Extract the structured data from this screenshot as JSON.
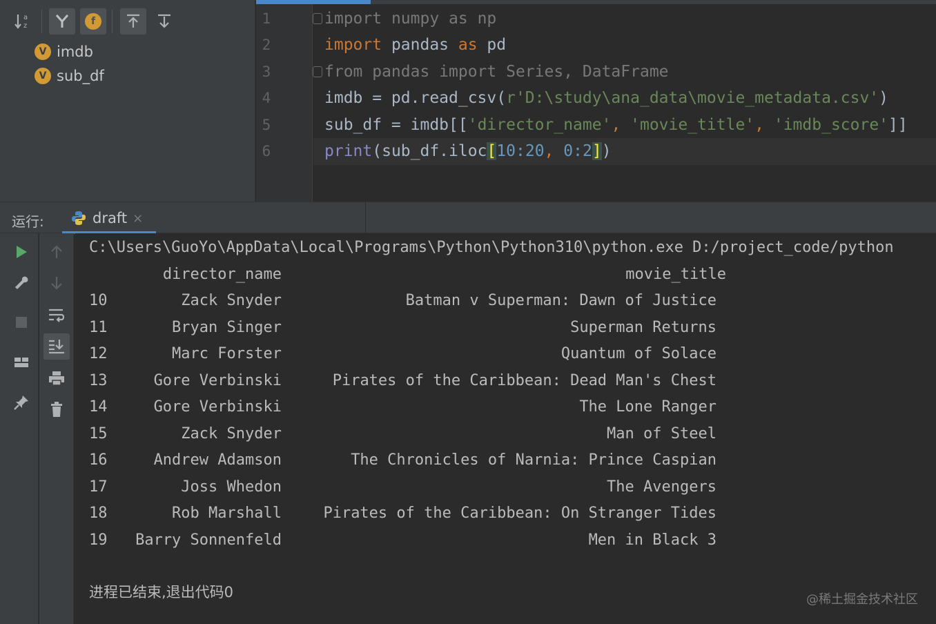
{
  "structure": {
    "items": [
      {
        "badge": "V",
        "label": "imdb"
      },
      {
        "badge": "V",
        "label": "sub_df"
      }
    ],
    "toolbar_icons": [
      "sort-alpha-icon",
      "filter-icon",
      "show-fields-icon",
      "expand-icon",
      "collapse-icon"
    ],
    "field_badge": "f"
  },
  "editor": {
    "lines": [
      {
        "no": "1"
      },
      {
        "no": "2"
      },
      {
        "no": "3"
      },
      {
        "no": "4"
      },
      {
        "no": "5"
      },
      {
        "no": "6"
      }
    ],
    "code": {
      "l1_import": "import",
      "l1_rest": " numpy ",
      "l1_as": "as",
      "l1_np": " np",
      "l2_import": "import",
      "l2_mod": " pandas ",
      "l2_as": "as",
      "l2_alias": " pd",
      "l3_from": "from",
      "l3_mod": " pandas ",
      "l3_import": "import",
      "l3_names": " Series, DataFrame",
      "l4_pre": "imdb = pd.read_csv(",
      "l4_str": "r'D:\\study\\ana_data\\movie_metadata.csv'",
      "l4_post": ")",
      "l5_pre": "sub_df = imdb[[",
      "l5_s1": "'director_name'",
      "l5_c1": ", ",
      "l5_s2": "'movie_title'",
      "l5_c2": ", ",
      "l5_s3": "'imdb_score'",
      "l5_post": "]]",
      "l6_print": "print",
      "l6_mid": "(sub_df.iloc",
      "l6_lb": "[",
      "l6_n1": "10",
      "l6_c1": ":",
      "l6_n2": "20",
      "l6_c2": ", ",
      "l6_n3": "0",
      "l6_c3": ":",
      "l6_n4": "2",
      "l6_rb": "]",
      "l6_post": ")"
    }
  },
  "run": {
    "label": "运行:",
    "tab_name": "draft",
    "tab_close": "×"
  },
  "console": {
    "command": "C:\\Users\\GuoYo\\AppData\\Local\\Programs\\Python\\Python310\\python.exe D:/project_code/python",
    "header_director": "director_name",
    "header_title": "movie_title",
    "rows": [
      {
        "idx": "10",
        "director": "Zack Snyder",
        "title": "Batman v Superman: Dawn of Justice"
      },
      {
        "idx": "11",
        "director": "Bryan Singer",
        "title": "Superman Returns"
      },
      {
        "idx": "12",
        "director": "Marc Forster",
        "title": "Quantum of Solace"
      },
      {
        "idx": "13",
        "director": "Gore Verbinski",
        "title": "Pirates of the Caribbean: Dead Man's Chest"
      },
      {
        "idx": "14",
        "director": "Gore Verbinski",
        "title": "The Lone Ranger"
      },
      {
        "idx": "15",
        "director": "Zack Snyder",
        "title": "Man of Steel"
      },
      {
        "idx": "16",
        "director": "Andrew Adamson",
        "title": "The Chronicles of Narnia: Prince Caspian"
      },
      {
        "idx": "17",
        "director": "Joss Whedon",
        "title": "The Avengers"
      },
      {
        "idx": "18",
        "director": "Rob Marshall",
        "title": "Pirates of the Caribbean: On Stranger Tides"
      },
      {
        "idx": "19",
        "director": "Barry Sonnenfeld",
        "title": "Men in Black 3"
      }
    ],
    "exit": "进程已结束,退出代码0"
  },
  "watermark": "@稀土掘金技术社区",
  "colors": {
    "keyword": "#cc7832",
    "string": "#6a8759",
    "number": "#6897bb",
    "builtin": "#8888c6",
    "accent": "#4a88c7"
  }
}
